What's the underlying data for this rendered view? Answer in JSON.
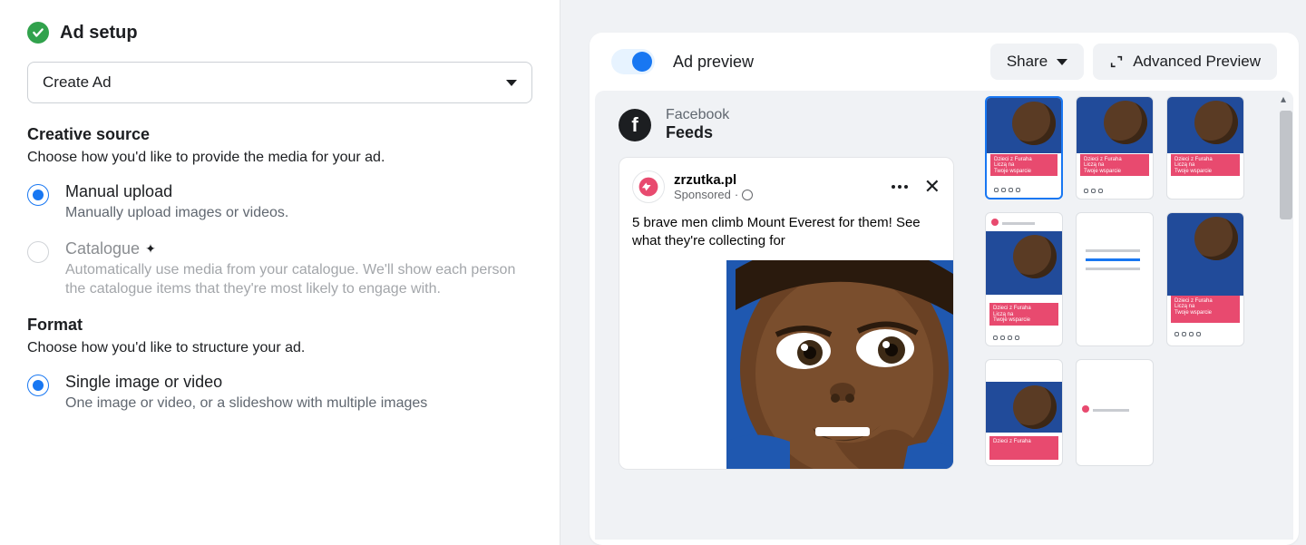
{
  "adSetup": {
    "title": "Ad setup",
    "dropdown": "Create Ad",
    "creativeSource": {
      "heading": "Creative source",
      "helper": "Choose how you'd like to provide the media for your ad.",
      "manual": {
        "title": "Manual upload",
        "desc": "Manually upload images or videos."
      },
      "catalogue": {
        "title": "Catalogue",
        "desc": "Automatically use media from your catalogue. We'll show each person the catalogue items that they're most likely to engage with."
      }
    },
    "format": {
      "heading": "Format",
      "helper": "Choose how you'd like to structure your ad.",
      "single": {
        "title": "Single image or video",
        "desc": "One image or video, or a slideshow with multiple images"
      }
    }
  },
  "preview": {
    "title": "Ad preview",
    "shareLabel": "Share",
    "advancedLabel": "Advanced Preview",
    "platform": {
      "name": "Facebook",
      "surface": "Feeds"
    },
    "post": {
      "brand": "zrzutka.pl",
      "sponsoredLabel": "Sponsored",
      "text": "5 brave men climb Mount Everest for them! See what they're collecting for"
    },
    "thumbText": {
      "line1": "Dzieci z Furaha",
      "line2": "Liczą na",
      "line3": "Twoje wsparcie"
    }
  }
}
